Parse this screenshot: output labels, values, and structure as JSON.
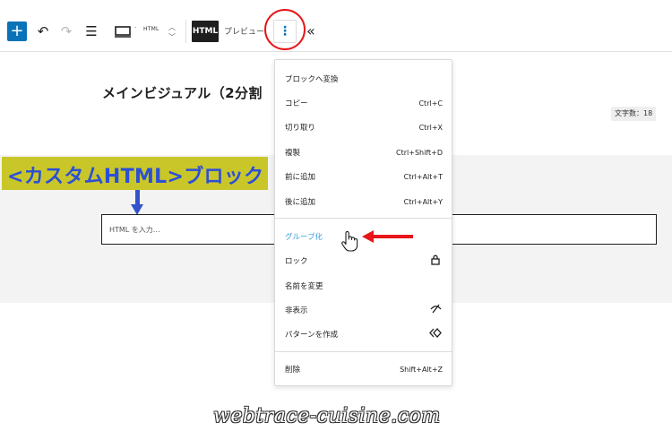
{
  "toolbar": {
    "add_label": "+",
    "undo_icon": "↶",
    "redo_icon": "↷",
    "outline_icon": "☰",
    "device_separator": "·",
    "html_small": "HTML",
    "block_label": "HTML",
    "preview_label": "プレビュー",
    "options_icon": "⋮",
    "collapse_icon": "«"
  },
  "editor": {
    "heading": "メインビジュアル（2分割",
    "char_count": "文字数：18",
    "html_placeholder": "HTML を入力…"
  },
  "annotation": {
    "callout": "<カスタムHTML>ブロック",
    "colors": {
      "callout_bg": "#c9c62a",
      "callout_text": "#2b4fd6",
      "arrow_red": "#e8161a"
    }
  },
  "menu": {
    "group1": [
      {
        "label": "ブロックへ変換",
        "shortcut": ""
      },
      {
        "label": "コピー",
        "shortcut": "Ctrl+C"
      },
      {
        "label": "切り取り",
        "shortcut": "Ctrl+X"
      },
      {
        "label": "複製",
        "shortcut": "Ctrl+Shift+D"
      },
      {
        "label": "前に追加",
        "shortcut": "Ctrl+Alt+T"
      },
      {
        "label": "後に追加",
        "shortcut": "Ctrl+Alt+Y"
      }
    ],
    "group2": [
      {
        "label": "グループ化",
        "shortcut": ""
      },
      {
        "label": "ロック",
        "icon": "lock-icon"
      },
      {
        "label": "名前を変更",
        "shortcut": ""
      },
      {
        "label": "非表示",
        "icon": "eye-off-icon"
      },
      {
        "label": "パターンを作成",
        "icon": "pattern-icon"
      }
    ],
    "group3": [
      {
        "label": "削除",
        "shortcut": "Shift+Alt+Z"
      }
    ]
  },
  "watermark": "webtrace-cuisine.com"
}
